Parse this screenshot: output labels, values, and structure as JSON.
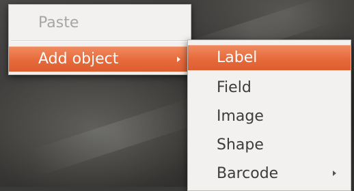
{
  "context_menu": {
    "items": [
      {
        "label": "Paste",
        "state": "disabled"
      },
      {
        "label": "Add object",
        "state": "highlighted",
        "has_submenu": true,
        "submenu_indicator": "submenu-arrow-icon"
      }
    ]
  },
  "add_object_submenu": {
    "items": [
      {
        "label": "Label",
        "state": "highlighted"
      },
      {
        "label": "Field",
        "state": "normal"
      },
      {
        "label": "Image",
        "state": "normal"
      },
      {
        "label": "Shape",
        "state": "normal"
      },
      {
        "label": "Barcode",
        "state": "normal",
        "has_submenu": true,
        "submenu_indicator": "submenu-arrow-icon"
      }
    ]
  },
  "colors": {
    "highlight": "#e76a3b",
    "menu_background": "#f2f1ef",
    "text": "#3c3c3c",
    "disabled_text": "#a6a6a3"
  }
}
